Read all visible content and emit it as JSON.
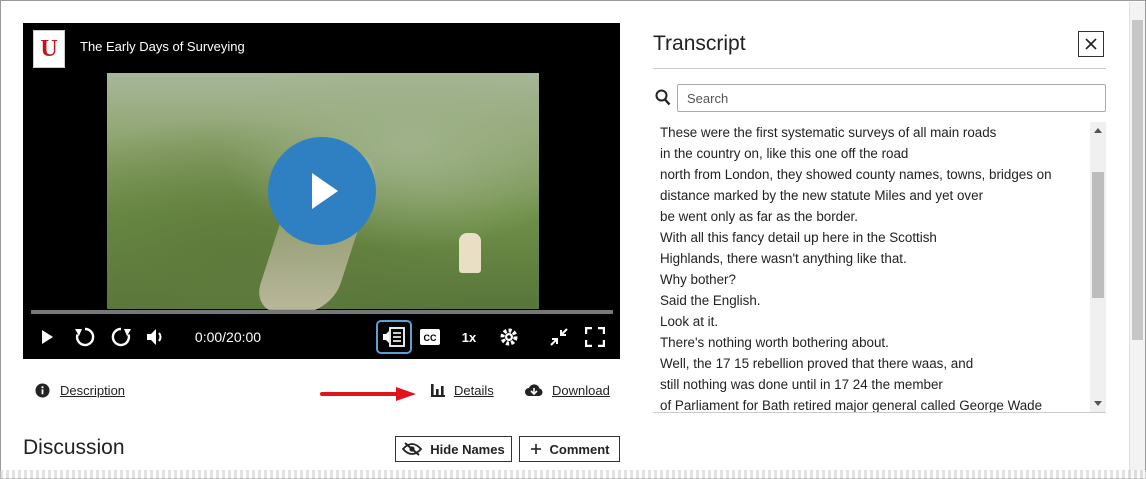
{
  "player": {
    "title": "The Early Days of Surveying",
    "logo_text": "U",
    "time": "0:00/20:00",
    "speed": "1x",
    "icons": [
      "play-icon",
      "rewind-icon",
      "forward-icon",
      "volume-icon",
      "transcript-icon",
      "captions-icon",
      "settings-icon",
      "collapse-icon",
      "fullscreen-icon"
    ]
  },
  "links": {
    "description": "Description",
    "details": "Details",
    "download": "Download"
  },
  "discussion": {
    "title": "Discussion",
    "hide_names": "Hide Names",
    "comment": "Comment"
  },
  "transcript": {
    "title": "Transcript",
    "search_placeholder": "Search",
    "lines": [
      "These were the first systematic surveys of all main roads",
      "in the country on, like this one off the road",
      "north from London, they showed county names, towns, bridges on",
      "distance marked by the new statute Miles and yet over",
      "be went only as far as the border.",
      "With all this fancy detail up here in the Scottish",
      "Highlands, there wasn't anything like that.",
      "Why bother?",
      "Said the English.",
      "Look at it.",
      "There's nothing worth bothering about.",
      "Well, the 17 15 rebellion proved that there waas, and",
      "still nothing was done until in 17 24 the member",
      "of Parliament for Bath retired major general called George Wade"
    ]
  },
  "colors": {
    "play_accent": "#2f80c2",
    "arrow": "#e0141c",
    "active_outline": "#5a9fd6"
  }
}
